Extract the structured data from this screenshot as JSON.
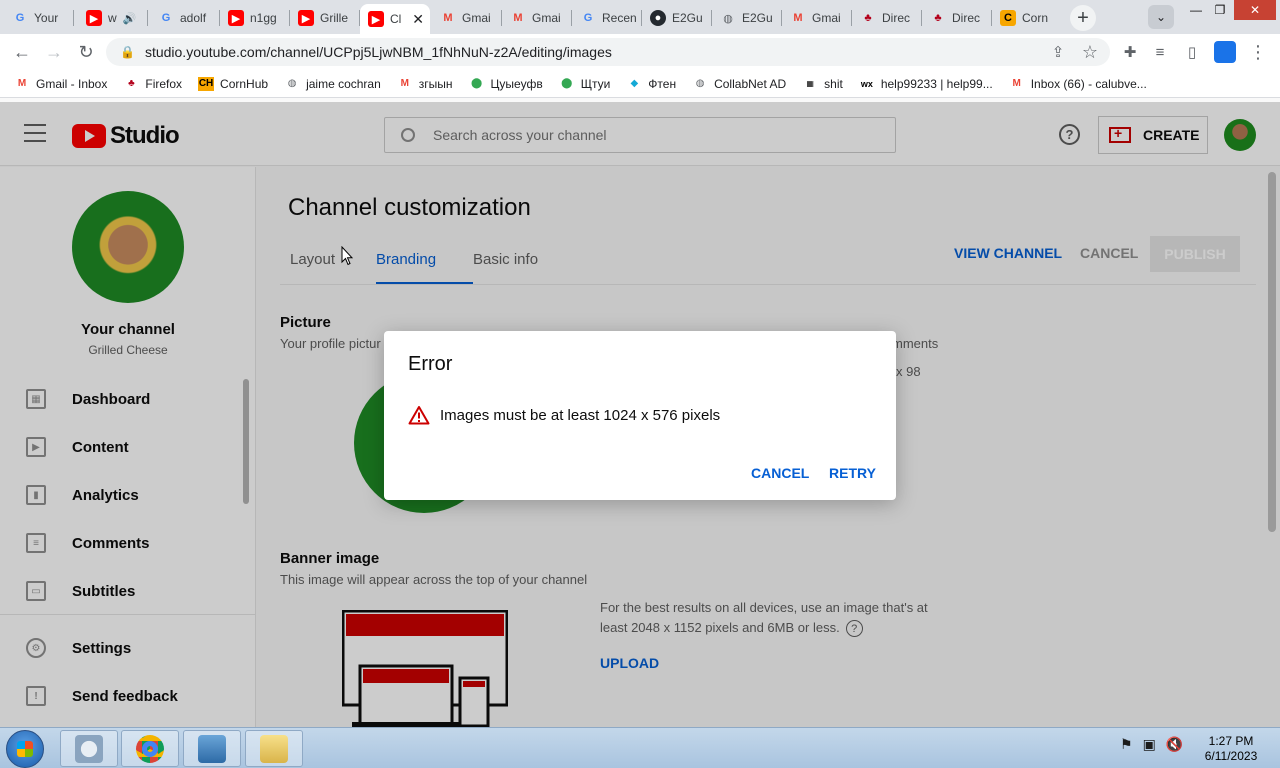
{
  "browser": {
    "tabs": [
      {
        "label": "Your ",
        "icon": "google-icon",
        "active": false
      },
      {
        "label": "w",
        "icon": "youtube-icon",
        "active": false
      },
      {
        "label": "adolf",
        "icon": "google-icon",
        "active": false
      },
      {
        "label": "n1gg",
        "icon": "youtube-icon",
        "active": false
      },
      {
        "label": "Grille",
        "icon": "youtube-icon",
        "active": false
      },
      {
        "label": "Cl",
        "icon": "youtube-icon",
        "active": true
      },
      {
        "label": "Gmai",
        "icon": "gmail-icon",
        "active": false
      },
      {
        "label": "Gmai",
        "icon": "gmail-icon",
        "active": false
      },
      {
        "label": "Recen",
        "icon": "google-icon",
        "active": false
      },
      {
        "label": "E2Gu",
        "icon": "github-icon",
        "active": false
      },
      {
        "label": "E2Gu",
        "icon": "globe-icon",
        "active": false
      },
      {
        "label": "Gmai",
        "icon": "gmail-icon",
        "active": false
      },
      {
        "label": "Direc",
        "icon": "bird-icon",
        "active": false
      },
      {
        "label": "Direc",
        "icon": "bird-icon",
        "active": false
      },
      {
        "label": "Corn",
        "icon": "cornhub-icon",
        "active": false
      }
    ],
    "url": "studio.youtube.com/channel/UCPpj5LjwNBM_1fNhNuN-z2A/editing/images",
    "bookmarks": [
      {
        "label": "Gmail - Inbox",
        "icon": "gmail-icon"
      },
      {
        "label": "Firefox",
        "icon": "bird-icon"
      },
      {
        "label": "CornHub",
        "icon": "cornhub-icon"
      },
      {
        "label": "jaime cochran",
        "icon": "globe-icon"
      },
      {
        "label": "згыын",
        "icon": "gmail-icon"
      },
      {
        "label": "Цуыеуфв",
        "icon": "maps-icon"
      },
      {
        "label": "Щтуи",
        "icon": "maps-icon"
      },
      {
        "label": "Фтен",
        "icon": "fork-icon"
      },
      {
        "label": "CollabNet AD",
        "icon": "globe-icon"
      },
      {
        "label": "shit",
        "icon": "hpb-icon"
      },
      {
        "label": "help99233 | help99...",
        "icon": "wix-icon"
      },
      {
        "label": "Inbox (66) - calubve...",
        "icon": "gmail-icon"
      }
    ]
  },
  "studio": {
    "logo_text": "Studio",
    "search_placeholder": "Search across your channel",
    "create_label": "CREATE"
  },
  "sidebar": {
    "channel_title": "Your channel",
    "channel_name": "Grilled Cheese",
    "items": [
      {
        "label": "Dashboard",
        "icon": "dashboard-icon"
      },
      {
        "label": "Content",
        "icon": "content-icon"
      },
      {
        "label": "Analytics",
        "icon": "analytics-icon"
      },
      {
        "label": "Comments",
        "icon": "comments-icon"
      },
      {
        "label": "Subtitles",
        "icon": "subtitles-icon"
      }
    ],
    "footer_items": [
      {
        "label": "Settings",
        "icon": "settings-icon"
      },
      {
        "label": "Send feedback",
        "icon": "feedback-icon"
      }
    ]
  },
  "main": {
    "page_title": "Channel customization",
    "tabs": [
      {
        "label": "Layout"
      },
      {
        "label": "Branding"
      },
      {
        "label": "Basic info"
      }
    ],
    "view_channel": "VIEW CHANNEL",
    "cancel": "CANCEL",
    "publish": "PUBLISH",
    "picture": {
      "title": "Picture",
      "desc": "Your profile pictur",
      "side_text_1": "mments",
      "side_text_2": "x 98"
    },
    "banner": {
      "title": "Banner image",
      "desc": "This image will appear across the top of your channel",
      "upload_desc": "For the best results on all devices, use an image that's at least 2048 x 1152 pixels and 6MB or less.",
      "upload": "UPLOAD"
    }
  },
  "dialog": {
    "title": "Error",
    "message": "Images must be at least 1024 x 576 pixels",
    "cancel": "CANCEL",
    "retry": "RETRY"
  },
  "taskbar": {
    "time": "1:27 PM",
    "date": "6/11/2023"
  },
  "colors": {
    "accent_blue": "#065fd4",
    "youtube_red": "#ff0000",
    "error_red": "#cc0000"
  }
}
